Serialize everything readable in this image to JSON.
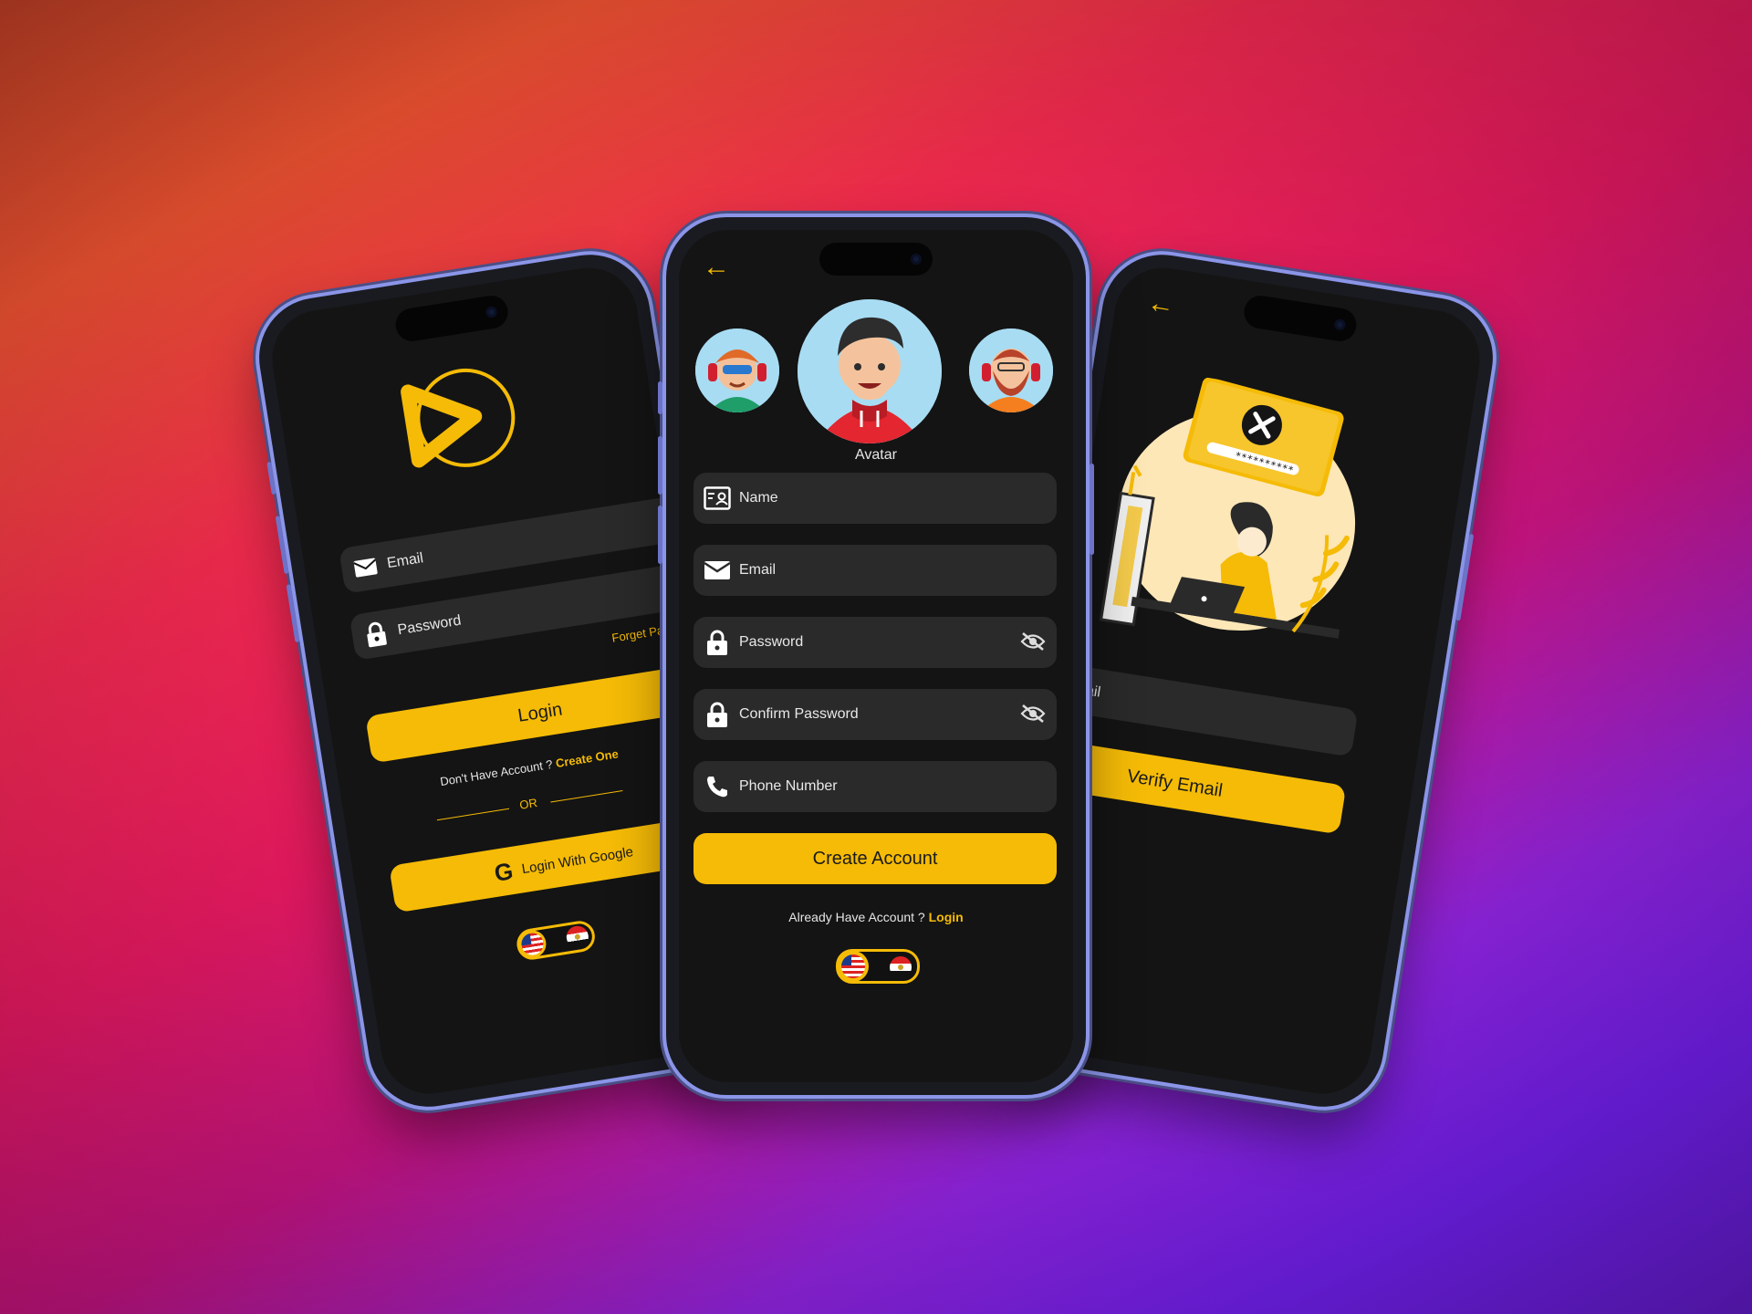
{
  "colors": {
    "accent": "#f5bb06",
    "screen_bg": "#141414",
    "field_bg": "#2a2a2a",
    "frame": "#8b95e8"
  },
  "login_screen": {
    "logo": "play-logo-icon",
    "email_placeholder": "Email",
    "password_placeholder": "Password",
    "forget_password": "Forget Passw",
    "login_button": "Login",
    "no_account_text": "Don't Have Account ?",
    "create_one_link": "Create One",
    "or_divider": "OR",
    "google_button": "Login With Google",
    "languages": [
      "en-US",
      "ar-EG"
    ]
  },
  "register_screen": {
    "avatar_label": "Avatar",
    "fields": [
      {
        "key": "name",
        "placeholder": "Name",
        "icon": "id-card-icon"
      },
      {
        "key": "email",
        "placeholder": "Email",
        "icon": "mail-icon"
      },
      {
        "key": "password",
        "placeholder": "Password",
        "icon": "lock-icon",
        "toggle": "eye-off-icon"
      },
      {
        "key": "confirm",
        "placeholder": "Confirm Password",
        "icon": "lock-icon",
        "toggle": "eye-off-icon"
      },
      {
        "key": "phone",
        "placeholder": "Phone Number",
        "icon": "phone-icon"
      }
    ],
    "create_button": "Create Account",
    "have_account_text": "Already Have Account ?",
    "login_link": "Login",
    "languages": [
      "en-US",
      "ar-EG"
    ]
  },
  "verify_screen": {
    "illustration": "forgot-password-illustration",
    "password_mask": "**********",
    "email_placeholder": "Email",
    "verify_button": "Verify Email"
  }
}
